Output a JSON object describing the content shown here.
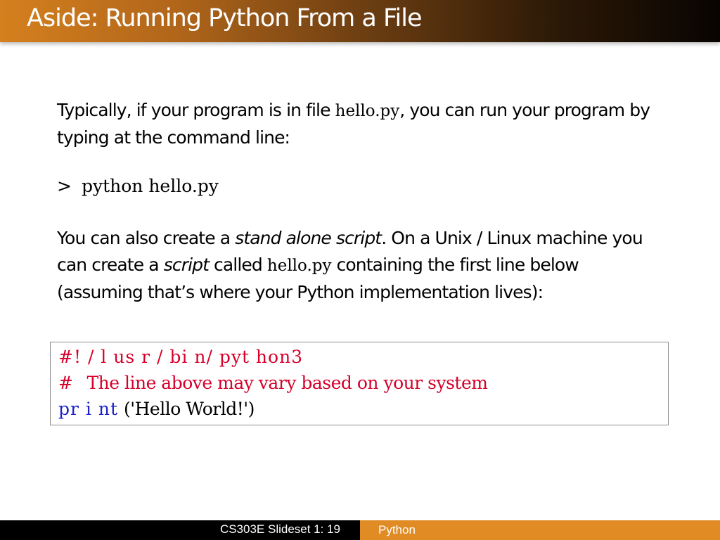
{
  "slide": {
    "title": "Aside: Running Python From a File",
    "para1": {
      "before": "Typically, if your program is in file ",
      "filename": "hello.py",
      "after": ", you can run your program by typing at the command line:"
    },
    "command": {
      "prompt": ">",
      "text": "python hello.py"
    },
    "para2": {
      "part1": "You can also create a ",
      "emph1": "stand alone script",
      "part2": ". On a Unix /  Linux machine you can create a ",
      "emph2": "script",
      "part3": " called ",
      "filename": "hello.py",
      "part4": " containing the first line below (assuming that’s where your Python implementation lives):"
    },
    "code": {
      "line1": "#! / l us r / bi n/ pyt hon3",
      "line2_hash": "#",
      "line2_text": "The line above may vary based on your system",
      "line3_keyword": "pr i nt",
      "line3_rest": "('Hello World!')"
    }
  },
  "footer": {
    "left": "CS303E Slideset 1: 19",
    "right": "Python"
  },
  "colors": {
    "title_bar_start": "#d5801e",
    "title_bar_end": "#080402",
    "code_comment": "#d6002a",
    "code_keyword": "#1c22c8",
    "footer_right_bg": "#e08b24"
  }
}
